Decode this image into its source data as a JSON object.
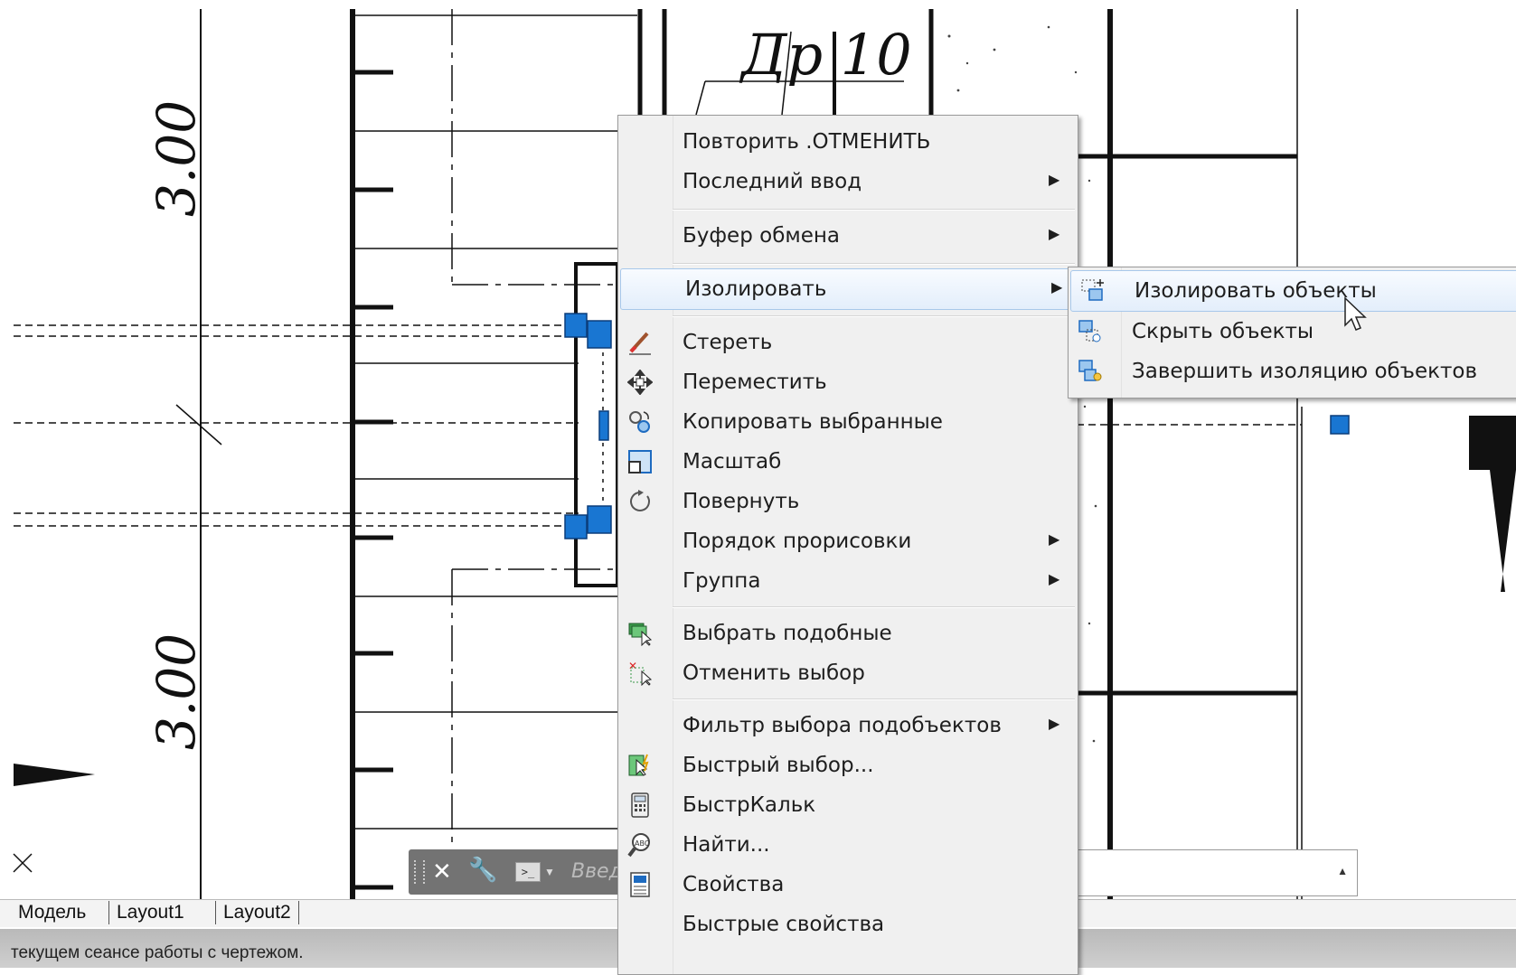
{
  "drawing": {
    "dim_top": "3.00",
    "dim_bottom": "3.00",
    "room_label": "Др 10"
  },
  "command_line": {
    "placeholder": "Введ"
  },
  "context_menu": {
    "items": [
      {
        "label": "Повторить .ОТМЕНИТЬ",
        "icon": "",
        "submenu": false
      },
      {
        "label": "Последний ввод",
        "icon": "",
        "submenu": true
      },
      {
        "label": "Буфер обмена",
        "icon": "",
        "submenu": true
      },
      {
        "label": "Изолировать",
        "icon": "",
        "submenu": true,
        "highlighted": true
      },
      {
        "label": "Стереть",
        "icon": "erase-icon",
        "submenu": false
      },
      {
        "label": "Переместить",
        "icon": "move-icon",
        "submenu": false
      },
      {
        "label": "Копировать выбранные",
        "icon": "copy-icon",
        "submenu": false
      },
      {
        "label": "Масштаб",
        "icon": "scale-icon",
        "submenu": false
      },
      {
        "label": "Повернуть",
        "icon": "rotate-icon",
        "submenu": false
      },
      {
        "label": "Порядок прорисовки",
        "icon": "",
        "submenu": true
      },
      {
        "label": "Группа",
        "icon": "",
        "submenu": true
      },
      {
        "label": "Выбрать подобные",
        "icon": "select-similar-icon",
        "submenu": false
      },
      {
        "label": "Отменить выбор",
        "icon": "deselect-icon",
        "submenu": false
      },
      {
        "label": "Фильтр выбора подобъектов",
        "icon": "",
        "submenu": true
      },
      {
        "label": "Быстрый выбор...",
        "icon": "quick-select-icon",
        "submenu": false
      },
      {
        "label": "БыстрКальк",
        "icon": "calculator-icon",
        "submenu": false
      },
      {
        "label": "Найти...",
        "icon": "find-icon",
        "submenu": false
      },
      {
        "label": "Свойства",
        "icon": "properties-icon",
        "submenu": false
      },
      {
        "label": "Быстрые свойства",
        "icon": "",
        "submenu": false
      }
    ]
  },
  "isolate_submenu": {
    "items": [
      {
        "label": "Изолировать объекты",
        "icon": "isolate-objects-icon",
        "highlighted": true
      },
      {
        "label": "Скрыть объекты",
        "icon": "hide-objects-icon"
      },
      {
        "label": "Завершить изоляцию объектов",
        "icon": "end-isolation-icon"
      }
    ]
  },
  "layout_tabs": [
    "Модель",
    "Layout1",
    "Layout2"
  ],
  "status_bar": {
    "text": "текущем сеансе работы с чертежом."
  },
  "colors": {
    "grip": "#1976d2",
    "menu_bg": "#f0f0f0",
    "highlight_border": "#a8c8ea"
  }
}
